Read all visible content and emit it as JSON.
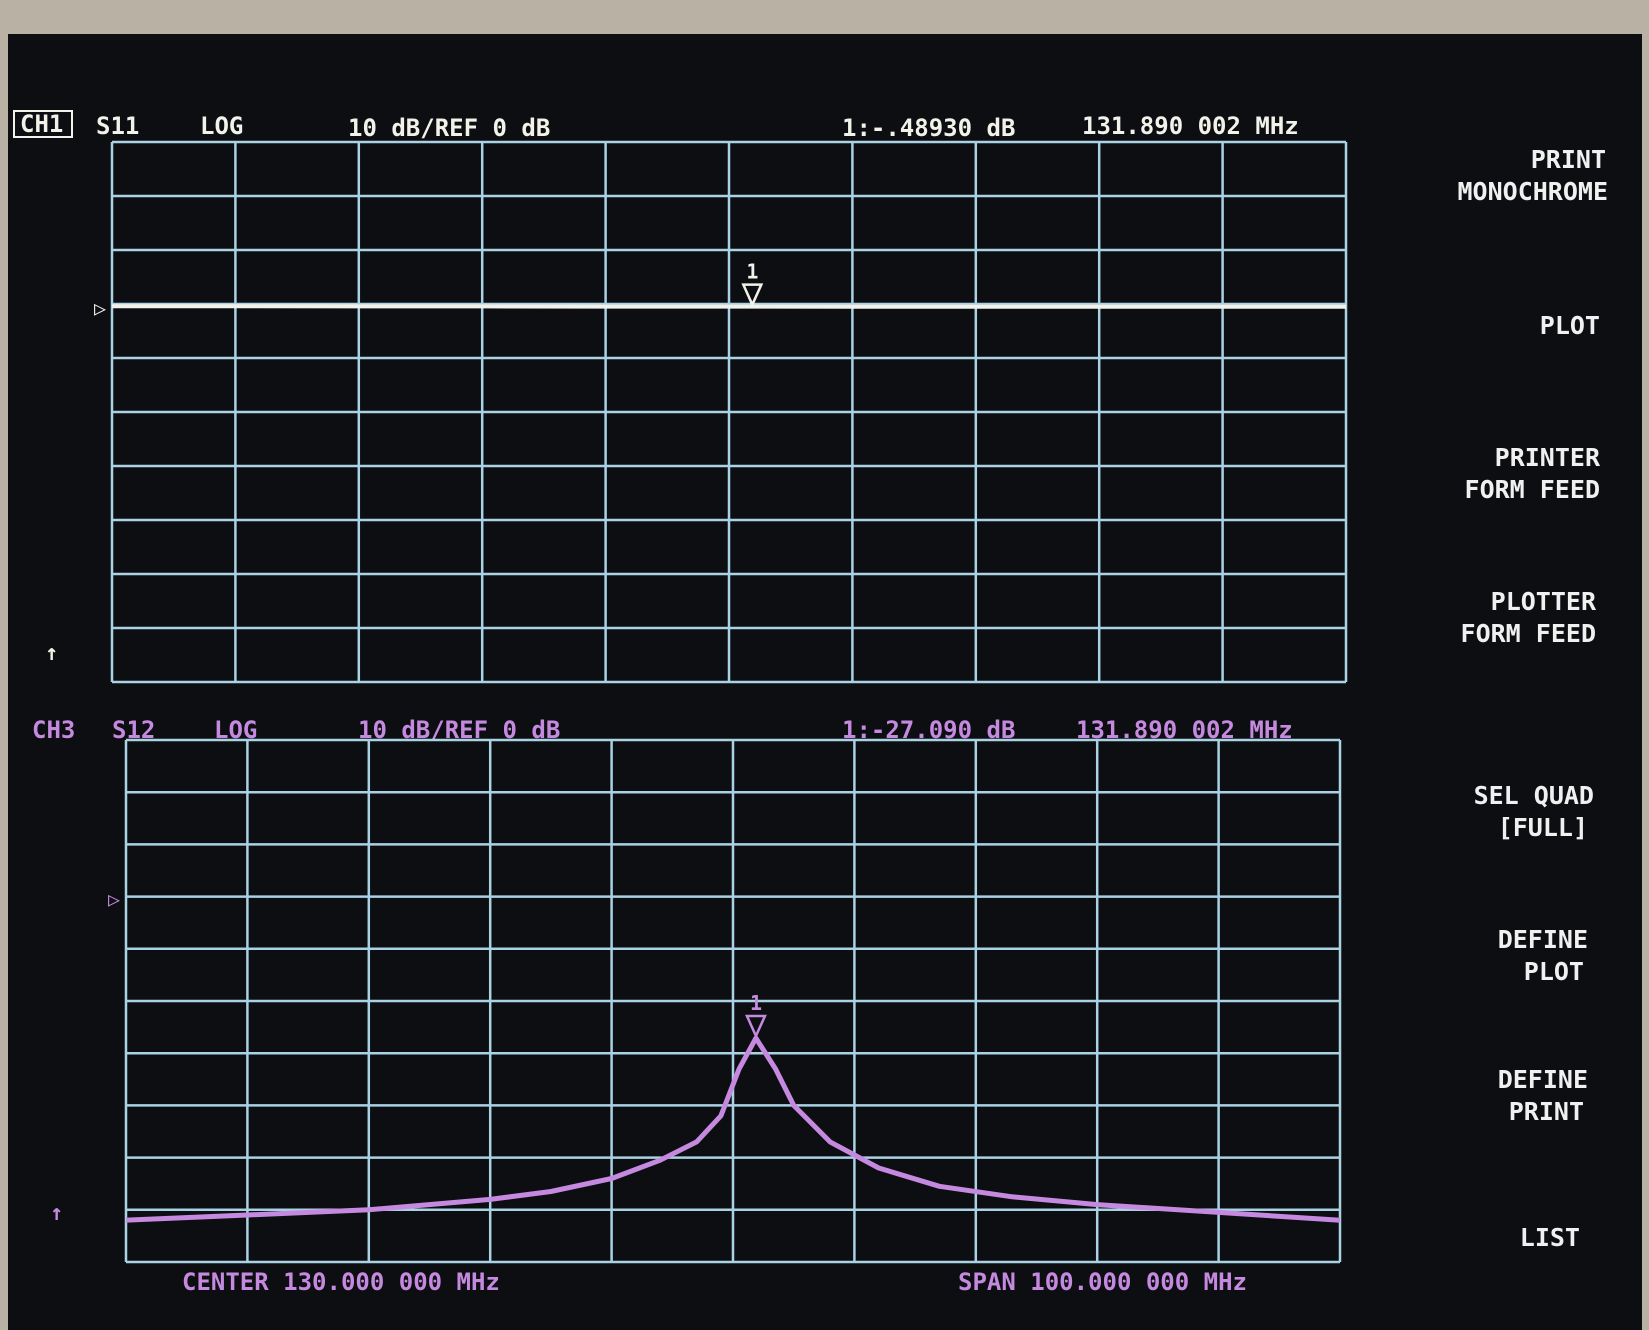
{
  "colors": {
    "background": "#0c0e12",
    "bezel": "#bdb6a8",
    "grid": "#a9d2e4",
    "ch1": "#f2f2ea",
    "ch1_trace_end": "#c8c07a",
    "ch3": "#c58ae0",
    "softkey": "#f0f0f0"
  },
  "channel1": {
    "label": "CH1",
    "parameter": "S11",
    "format": "LOG",
    "scale": "10 dB/REF 0 dB",
    "marker_readout": "1:-.48930 dB",
    "marker_freq": "131.890 002 MHz",
    "marker_label": "1"
  },
  "channel3": {
    "label": "CH3",
    "parameter": "S12",
    "format": "LOG",
    "scale": "10 dB/REF 0 dB",
    "marker_readout": "1:-27.090 dB",
    "marker_freq": "131.890 002 MHz",
    "marker_label": "1"
  },
  "footer": {
    "center": "CENTER 130.000 000 MHz",
    "span": "SPAN 100.000 000 MHz"
  },
  "softkeys": [
    {
      "line1": "PRINT",
      "line2": "MONOCHROME"
    },
    {
      "line1": "PLOT",
      "line2": ""
    },
    {
      "line1": "PRINTER",
      "line2": "FORM FEED"
    },
    {
      "line1": "PLOTTER",
      "line2": "FORM FEED"
    },
    {
      "line1": "SEL QUAD",
      "line2": "[FULL]"
    },
    {
      "line1": "DEFINE",
      "line2": "PLOT"
    },
    {
      "line1": "DEFINE",
      "line2": "PRINT"
    },
    {
      "line1": "LIST",
      "line2": ""
    }
  ],
  "chart_data": [
    {
      "type": "line",
      "title": "CH1 S11 LOG 10 dB/REF 0 dB",
      "xlabel": "",
      "ylabel": "",
      "xlim": [
        80,
        180
      ],
      "ylim": [
        -70,
        30
      ],
      "grid": true,
      "x_divisions": 10,
      "y_divisions": 10,
      "series": [
        {
          "x": [
            80,
            90,
            100,
            110,
            120,
            130,
            140,
            150,
            160,
            170,
            180
          ],
          "y": [
            -0.4,
            -0.4,
            -0.45,
            -0.45,
            -0.48,
            -0.49,
            -0.5,
            -0.5,
            -0.5,
            -0.5,
            -0.5
          ]
        }
      ],
      "marker": {
        "label": "1",
        "x": 131.890002,
        "y": -0.4893
      }
    },
    {
      "type": "line",
      "title": "CH3 S12 LOG 10 dB/REF 0 dB",
      "xlabel": "",
      "ylabel": "",
      "xlim": [
        80,
        180
      ],
      "ylim": [
        -70,
        30
      ],
      "grid": true,
      "x_divisions": 10,
      "y_divisions": 10,
      "series": [
        {
          "x": [
            80,
            90,
            100,
            110,
            115,
            120,
            124,
            127,
            129,
            130.5,
            131.89,
            133.5,
            135,
            138,
            142,
            147,
            153,
            160,
            170,
            180
          ],
          "y": [
            -62,
            -61,
            -60,
            -58,
            -56.5,
            -54,
            -50.5,
            -47,
            -42,
            -33,
            -27.1,
            -33,
            -40,
            -47,
            -52,
            -55.5,
            -57.5,
            -59,
            -60.5,
            -62
          ]
        }
      ],
      "marker": {
        "label": "1",
        "x": 131.890002,
        "y": -27.09
      }
    }
  ]
}
